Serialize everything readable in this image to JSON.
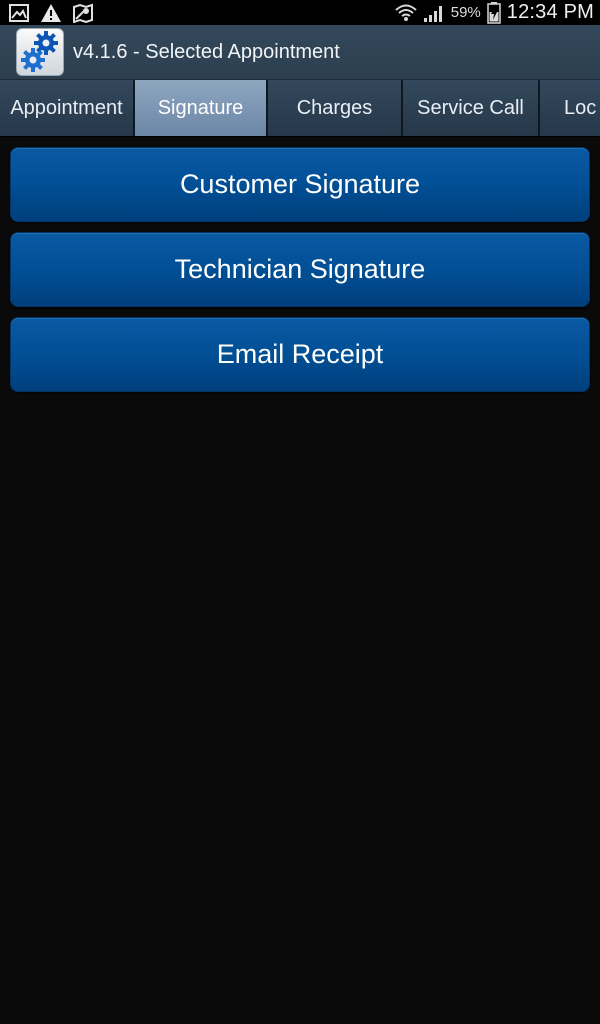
{
  "status_bar": {
    "left_icons": [
      "gallery-icon",
      "warning-icon",
      "maps-icon"
    ],
    "right_icons": [
      "wifi-icon",
      "signal-icon",
      "battery-icon"
    ],
    "battery_percent": "59%",
    "time": "12:34 PM"
  },
  "app": {
    "icon": "gears-icon",
    "title": "v4.1.6 - Selected Appointment"
  },
  "tabs": [
    {
      "label": "Appointment",
      "selected": false
    },
    {
      "label": "Signature",
      "selected": true
    },
    {
      "label": "Charges",
      "selected": false
    },
    {
      "label": "Service Call",
      "selected": false
    },
    {
      "label": "Loc",
      "selected": false
    }
  ],
  "actions": {
    "customer_signature": "Customer Signature",
    "technician_signature": "Technician Signature",
    "email_receipt": "Email Receipt"
  },
  "colors": {
    "button_blue": "#014f95",
    "selected_tab": "#7a93b2",
    "action_bar": "#2f4456",
    "background": "#0a0a0a"
  }
}
